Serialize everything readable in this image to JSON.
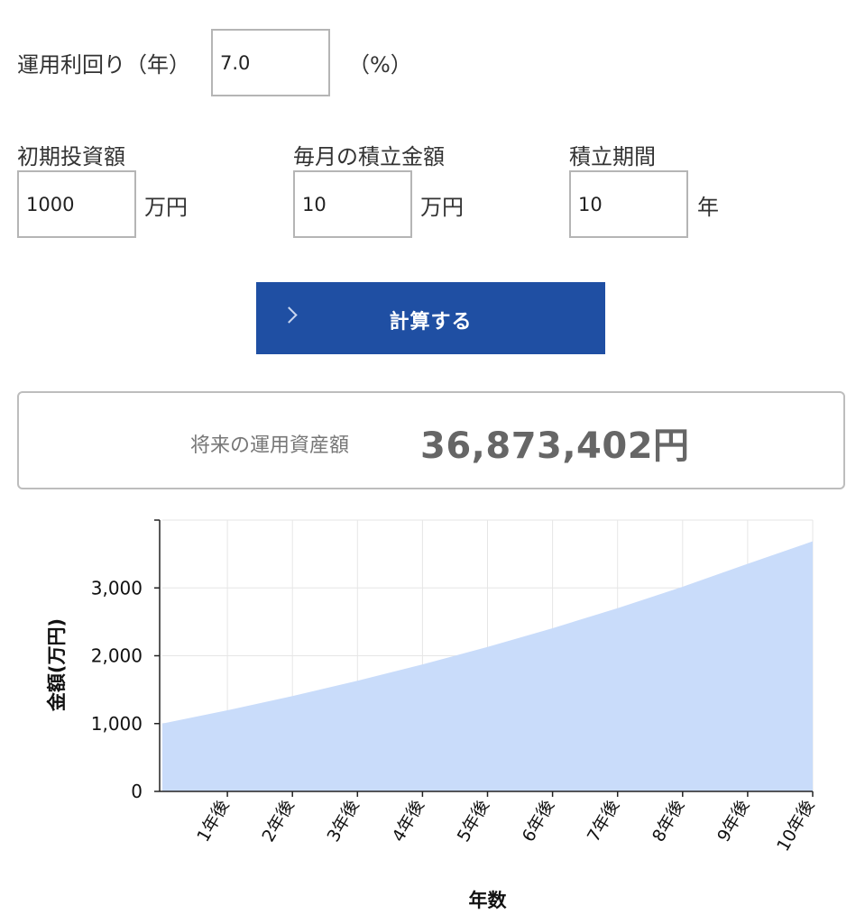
{
  "rate": {
    "label": "運用利回り（年）",
    "value": "7.0",
    "unit": "（%）"
  },
  "initial": {
    "label": "初期投資額",
    "value": "1000",
    "unit": "万円"
  },
  "monthly": {
    "label": "毎月の積立金額",
    "value": "10",
    "unit": "万円"
  },
  "period": {
    "label": "積立期間",
    "value": "10",
    "unit": "年"
  },
  "calc_button": {
    "label": "計算する",
    "icon": "chevron-right-icon"
  },
  "result": {
    "label": "将来の運用資産額",
    "value": "36,873,402円"
  },
  "colors": {
    "accent": "#1f4fa3",
    "area_fill": "#c9dcfa"
  },
  "chart_data": {
    "type": "area",
    "ylabel": "金額(万円)",
    "xlabel": "年数",
    "x": [
      0,
      1,
      2,
      3,
      4,
      5,
      6,
      7,
      8,
      9,
      10
    ],
    "x_tick_labels": [
      "1年後",
      "2年後",
      "3年後",
      "4年後",
      "5年後",
      "6年後",
      "7年後",
      "8年後",
      "9年後",
      "10年後"
    ],
    "y_tick_labels": [
      "0",
      "1,000",
      "2,000",
      "3,000"
    ],
    "y_ticks": [
      0,
      1000,
      2000,
      3000
    ],
    "values": [
      1000,
      1196,
      1406,
      1631,
      1872,
      2130,
      2406,
      2701,
      3017,
      3356,
      3687
    ],
    "ylim": [
      0,
      4000
    ],
    "xlim": [
      0,
      10
    ],
    "grid": true,
    "legend": "none"
  }
}
